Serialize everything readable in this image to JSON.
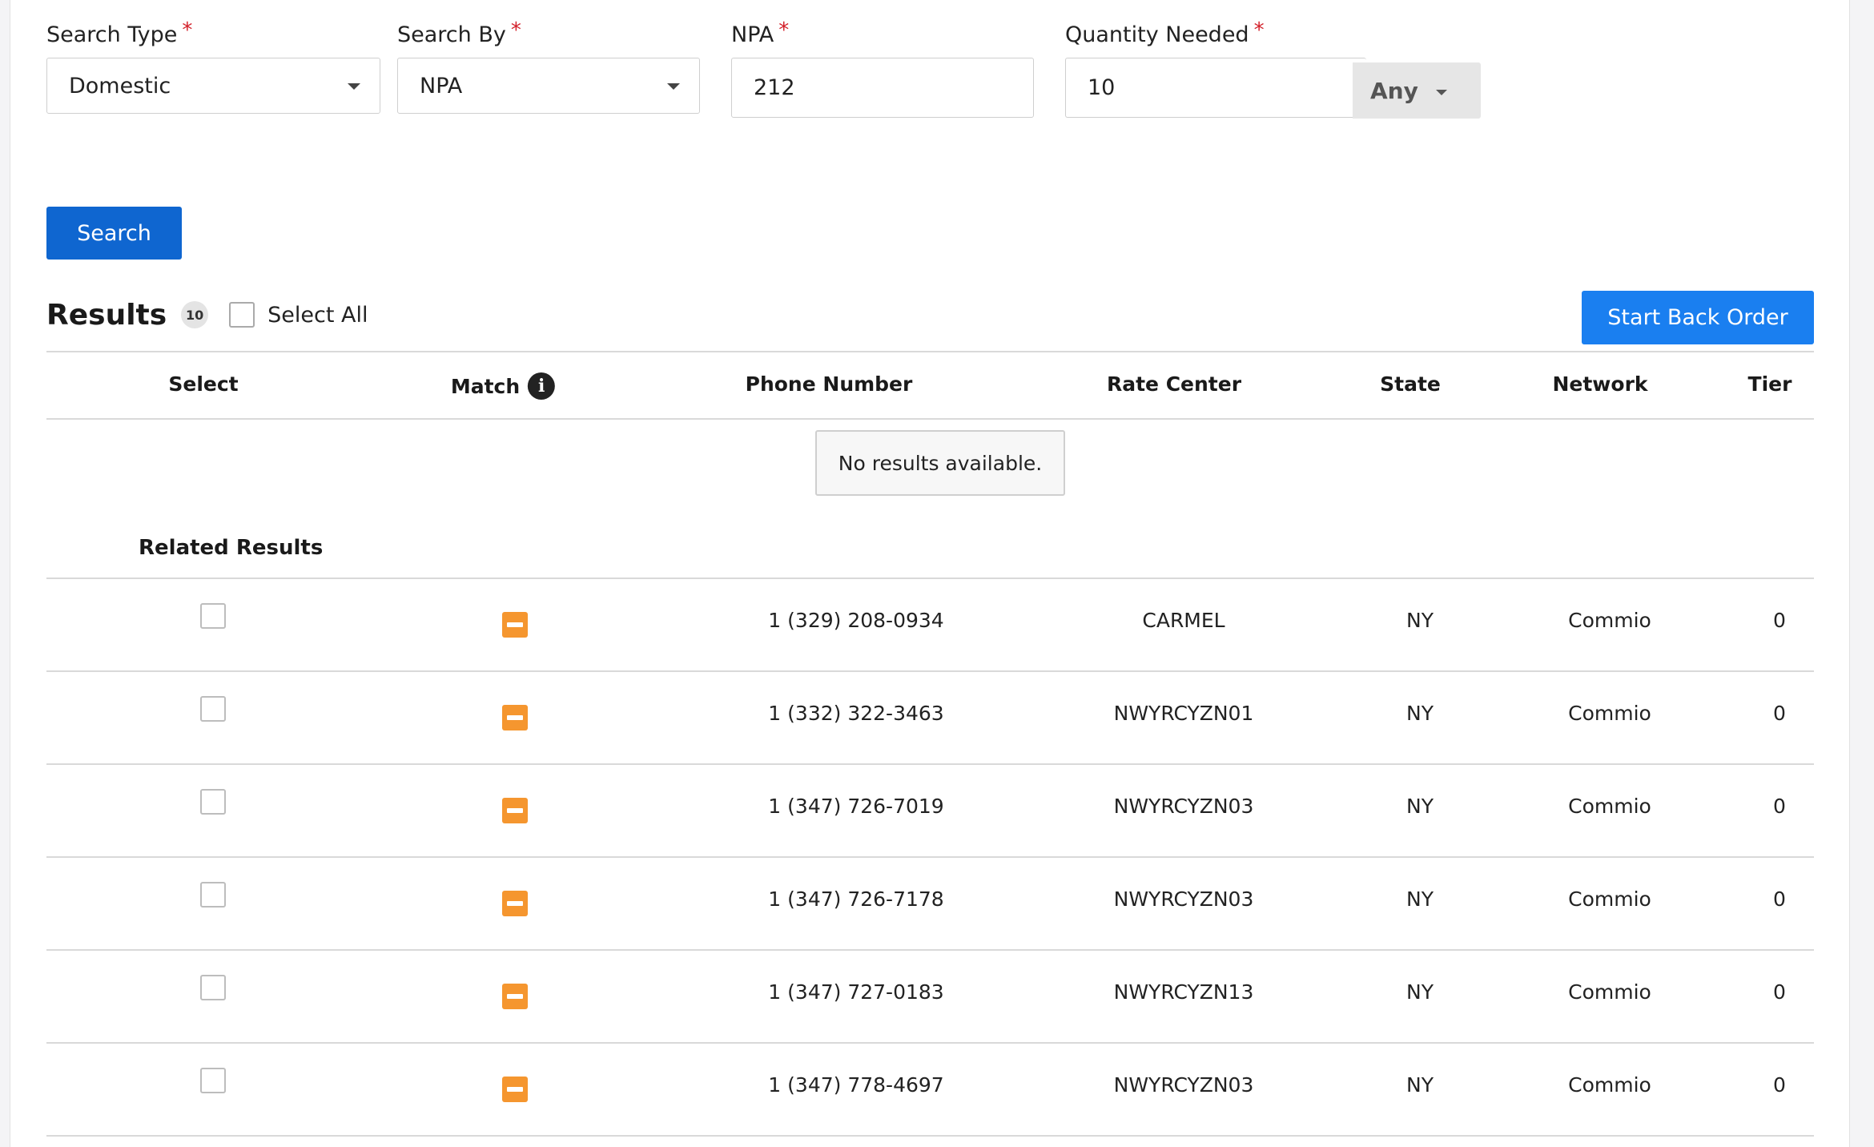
{
  "form": {
    "search_type": {
      "label": "Search Type",
      "required": "*",
      "value": "Domestic"
    },
    "search_by": {
      "label": "Search By",
      "required": "*",
      "value": "NPA"
    },
    "npa": {
      "label": "NPA",
      "required": "*",
      "value": "212"
    },
    "quantity": {
      "label": "Quantity Needed",
      "required": "*",
      "value": "10",
      "modifier": "Any"
    },
    "search_button": "Search"
  },
  "results": {
    "title": "Results",
    "count": "10",
    "select_all_label": "Select All",
    "back_order_button": "Start Back Order",
    "columns": {
      "select": "Select",
      "match": "Match",
      "phone": "Phone Number",
      "rate_center": "Rate Center",
      "state": "State",
      "network": "Network",
      "tier": "Tier"
    },
    "empty_message": "No results available.",
    "related_title": "Related Results",
    "rows": [
      {
        "phone": "1 (329) 208-0934",
        "rate_center": "CARMEL",
        "state": "NY",
        "network": "Commio",
        "tier": "0"
      },
      {
        "phone": "1 (332) 322-3463",
        "rate_center": "NWYRCYZN01",
        "state": "NY",
        "network": "Commio",
        "tier": "0"
      },
      {
        "phone": "1 (347) 726-7019",
        "rate_center": "NWYRCYZN03",
        "state": "NY",
        "network": "Commio",
        "tier": "0"
      },
      {
        "phone": "1 (347) 726-7178",
        "rate_center": "NWYRCYZN03",
        "state": "NY",
        "network": "Commio",
        "tier": "0"
      },
      {
        "phone": "1 (347) 727-0183",
        "rate_center": "NWYRCYZN13",
        "state": "NY",
        "network": "Commio",
        "tier": "0"
      },
      {
        "phone": "1 (347) 778-4697",
        "rate_center": "NWYRCYZN03",
        "state": "NY",
        "network": "Commio",
        "tier": "0"
      }
    ]
  },
  "icons": {
    "info": "info-icon",
    "match": "partial-match-icon",
    "dropdown": "caret-down-icon"
  },
  "colors": {
    "primary": "#0f66d0",
    "secondary_button": "#1a7ff0",
    "match_partial": "#f5962f",
    "required": "#d3202a"
  }
}
